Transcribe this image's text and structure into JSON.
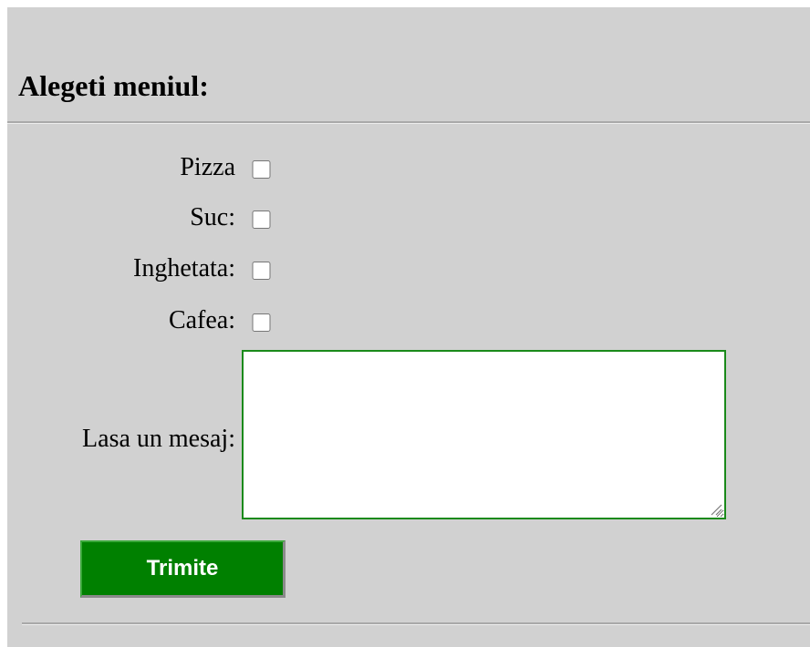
{
  "form": {
    "title": "Alegeti meniul:",
    "options": [
      {
        "label": "Pizza",
        "checked": false
      },
      {
        "label": "Suc:",
        "checked": false
      },
      {
        "label": "Inghetata:",
        "checked": false
      },
      {
        "label": "Cafea:",
        "checked": false
      }
    ],
    "message_label": "Lasa un mesaj:",
    "message_value": "",
    "submit_label": "Trimite"
  },
  "colors": {
    "background": "#d1d1d1",
    "accent": "#008000",
    "textarea_border": "#1a8a1a"
  }
}
